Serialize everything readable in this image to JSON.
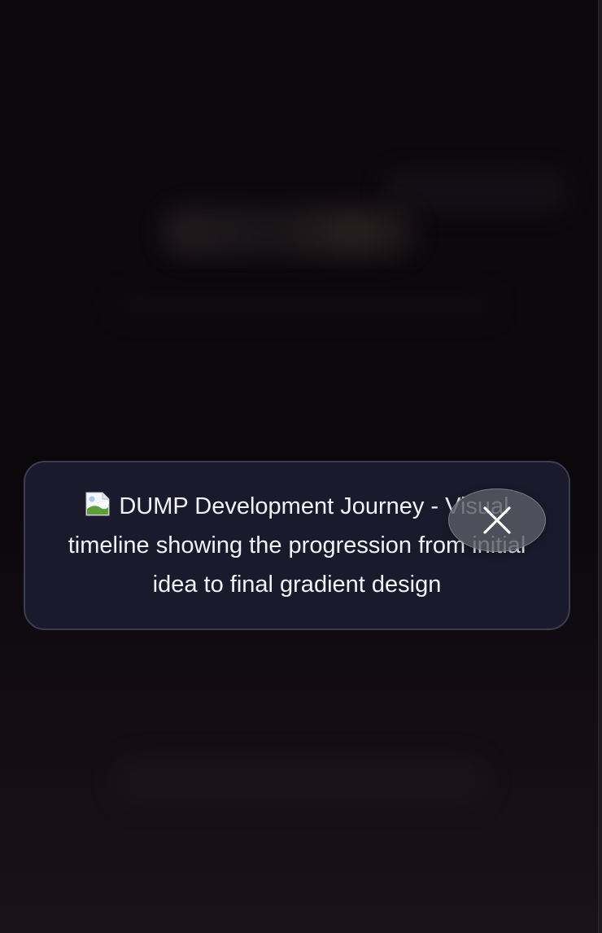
{
  "lightbox": {
    "image_alt": "DUMP Development Journey - Visual timeline showing the progression from initial idea to final gradient design",
    "broken_image_icon": "broken-image-icon",
    "close_icon": "close-icon"
  },
  "colors": {
    "backdrop": "#0b080d",
    "card_background": "#1b1a2c",
    "card_border": "#3e3d50",
    "text": "#f2f2f6",
    "close_button": "#5c5c66"
  }
}
